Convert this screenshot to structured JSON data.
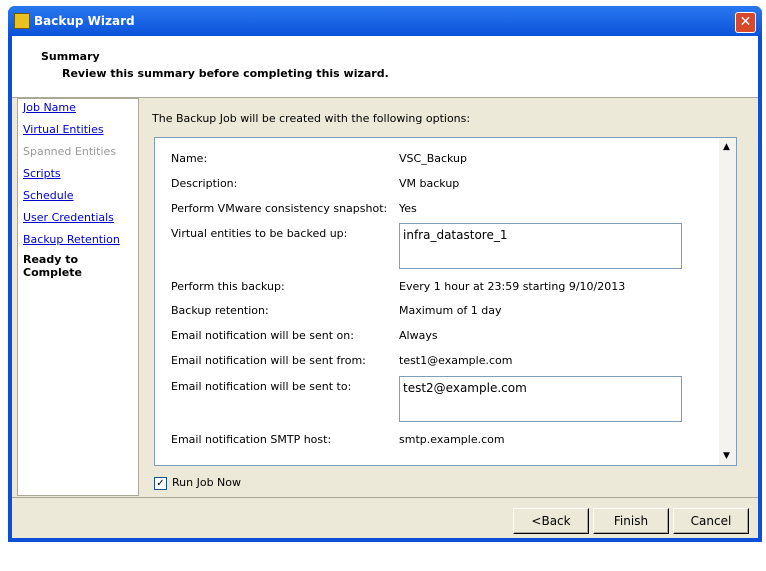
{
  "window": {
    "title": "Backup Wizard"
  },
  "header": {
    "title": "Summary",
    "subtitle": "Review this summary before completing this wizard."
  },
  "nav": [
    {
      "label": "Job Name",
      "state": "link"
    },
    {
      "label": "Virtual Entities",
      "state": "link"
    },
    {
      "label": "Spanned Entities",
      "state": "disabled"
    },
    {
      "label": "Scripts",
      "state": "link"
    },
    {
      "label": "Schedule",
      "state": "link"
    },
    {
      "label": "User Credentials",
      "state": "link"
    },
    {
      "label": "Backup Retention",
      "state": "link"
    },
    {
      "label": "Ready to Complete",
      "state": "current"
    }
  ],
  "intro": "The Backup Job will be created with the following options:",
  "summary": {
    "name_label": "Name:",
    "name": "VSC_Backup",
    "desc_label": "Description:",
    "desc": "VM backup",
    "snap_label": "Perform VMware consistency snapshot:",
    "snap": "Yes",
    "entities_label": "Virtual entities to be backed up:",
    "entities": "infra_datastore_1",
    "perform_label": "Perform this backup:",
    "perform": "Every 1 hour at 23:59 starting 9/10/2013",
    "ret_label": "Backup retention:",
    "ret": "Maximum of 1 day",
    "on_label": "Email notification will be sent on:",
    "on": "Always",
    "from_label": "Email notification will be sent from:",
    "from": "test1@example.com",
    "to_label": "Email notification will be sent to:",
    "to": "test2@example.com",
    "smtp_label": "Email notification SMTP host:",
    "smtp": "smtp.example.com"
  },
  "run_now": {
    "label": "Run Job Now",
    "checked": true
  },
  "buttons": {
    "back": "<Back",
    "finish": "Finish",
    "cancel": "Cancel"
  }
}
